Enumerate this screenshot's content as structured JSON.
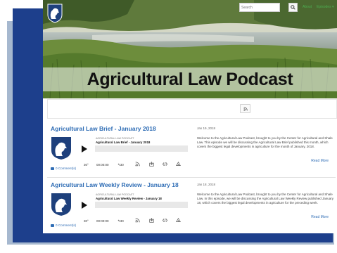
{
  "navbar": {
    "search_placeholder": "Search",
    "about_label": "About",
    "episodes_label": "Episodes ▾"
  },
  "hero": {
    "title": "Agricultural Law Podcast"
  },
  "episodes": [
    {
      "title": "Agricultural Law Brief - January 2018",
      "podcast_label": "AGRICULTURAL LAW PODCAST",
      "player_title": "Agricultural Law Brief - January 2018",
      "speed": "30°",
      "time": "00:00:00",
      "skip": "↰30",
      "date": "Jan 19, 2018",
      "description": "Welcome to the Agricultural Law Podcast, brought to you by the Center for Agricultural and Shale Law. This episode we will be discussing the Agricultural Law Brief published this month, which covers the biggest legal developments in agriculture for the month of January, 2018.",
      "read_more": "Read More",
      "comments": "0 Comment(s)"
    },
    {
      "title": "Agricultural Law Weekly Review - January 18",
      "podcast_label": "AGRICULTURAL LAW PODCAST",
      "player_title": "Agricultural Law Weekly Review - January 18",
      "speed": "30°",
      "time": "00:00:00",
      "skip": "↰30",
      "date": "Jan 18, 2018",
      "description": "Welcome to the Agricultural Law Podcast, brought to you by the Center for Agricultural and Shale Law. In this episode, we will be discussing the Agricultural Law Weekly Review published January 18, which covers the biggest legal developments in agriculture for the preceding week.",
      "read_more": "Read More",
      "comments": "0 Comment(s)"
    }
  ],
  "icons": {
    "logo": "penn-state-shield-icon",
    "search": "search-icon",
    "rss": "rss-icon",
    "play": "play-icon",
    "download": "download-icon",
    "embed": "embed-code-icon",
    "share": "share-icon",
    "comment": "comment-icon"
  },
  "colors": {
    "link_blue": "#2f6db5",
    "nav_green": "#4caf50",
    "frame_navy": "#1d3f8c",
    "frame_shadow": "#a6b8cf"
  }
}
